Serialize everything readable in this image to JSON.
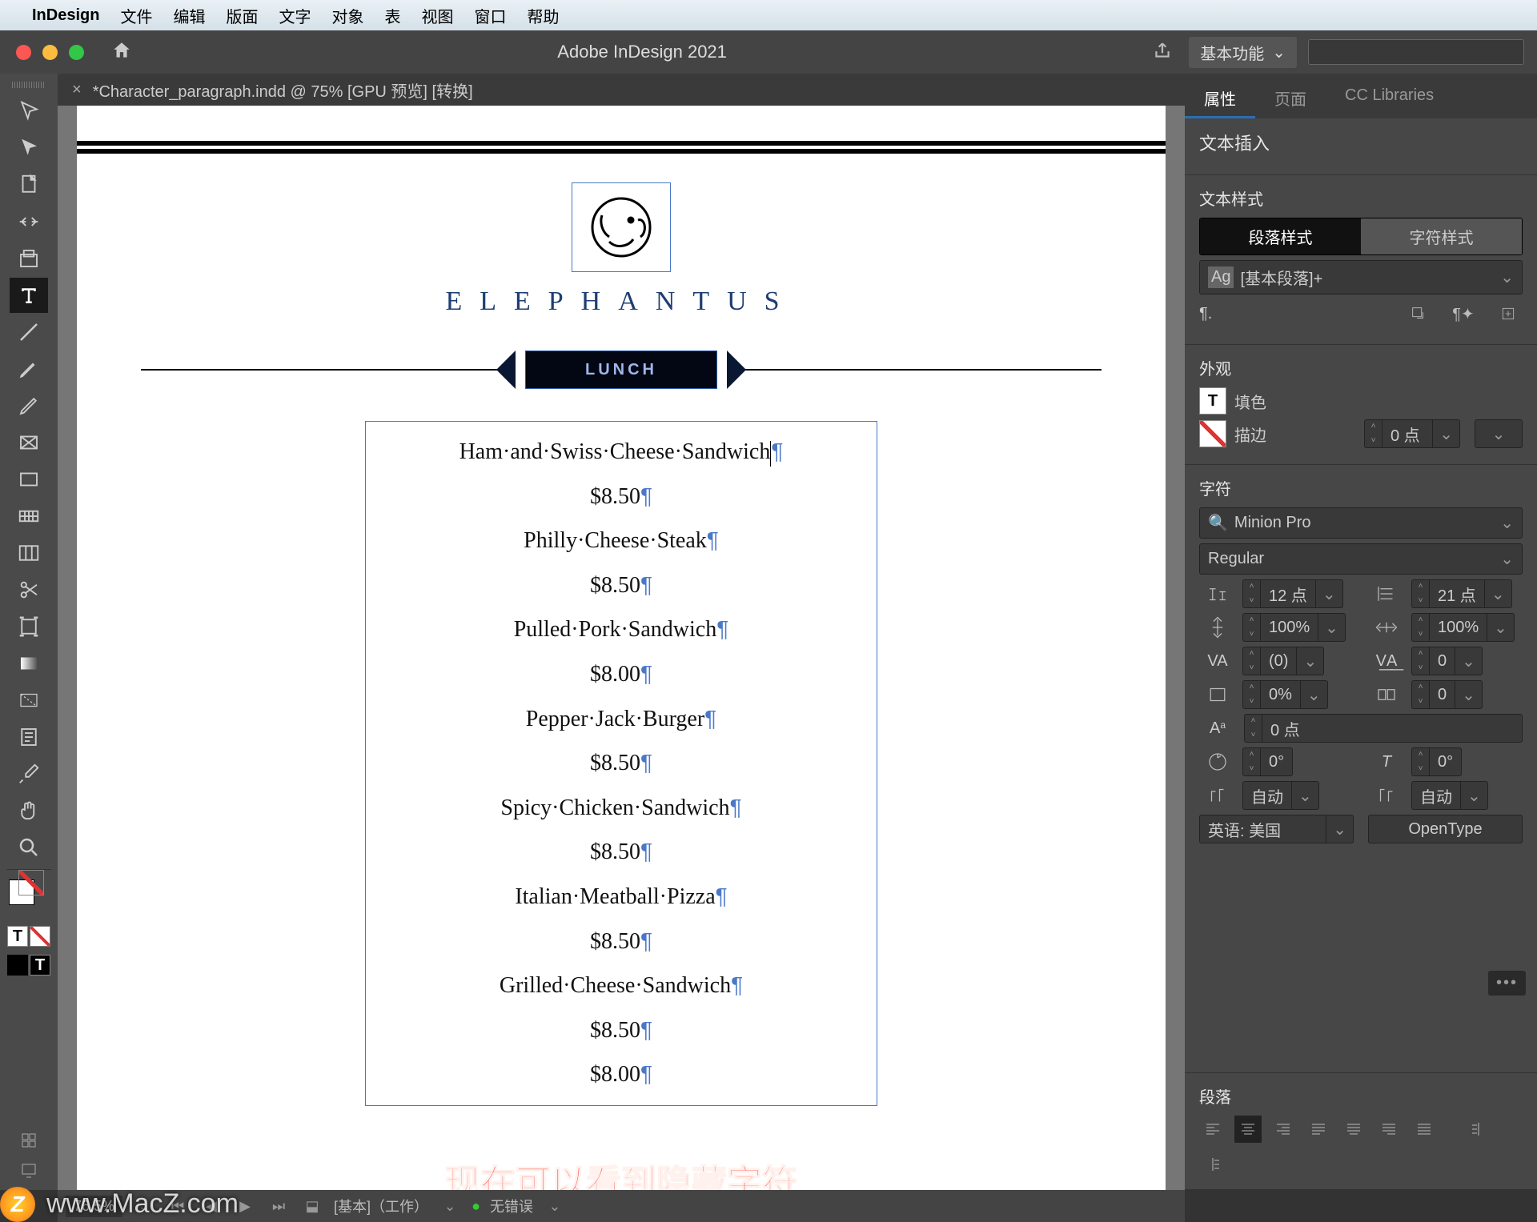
{
  "menubar": {
    "items": [
      "InDesign",
      "文件",
      "编辑",
      "版面",
      "文字",
      "对象",
      "表",
      "视图",
      "窗口",
      "帮助"
    ]
  },
  "appbar": {
    "title": "Adobe InDesign 2021",
    "workspace": "基本功能"
  },
  "doctab": {
    "label": "*Character_paragraph.indd @ 75% [GPU 预览] [转换]"
  },
  "rpanel": {
    "tabs": [
      "属性",
      "页面",
      "CC Libraries"
    ],
    "insert_label": "文本插入",
    "textstyle": {
      "title": "文本样式",
      "seg": [
        "段落样式",
        "字符样式"
      ],
      "style_name": "[基本段落]+",
      "pilcrow": "¶."
    },
    "appearance": {
      "title": "外观",
      "fill": "填色",
      "stroke": "描边",
      "stroke_val": "0 点"
    },
    "character": {
      "title": "字符",
      "font": "Minion Pro",
      "weight": "Regular",
      "size": "12 点",
      "leading": "21 点",
      "hscale": "100%",
      "vscale": "100%",
      "kerning": "(0)",
      "tracking": "0",
      "baseline": "0%",
      "other0": "0",
      "shift": "0 点",
      "rot1": "0°",
      "rot2": "0°",
      "auto1": "自动",
      "auto2": "自动",
      "lang": "英语: 美国",
      "opentype": "OpenType"
    },
    "paragraph": {
      "title": "段落"
    }
  },
  "doc": {
    "brand": "ELEPHANTUS",
    "lunch": "LUNCH",
    "menu": [
      {
        "name": "Ham·and·Swiss·Cheese·Sandwich",
        "price": "$8.50"
      },
      {
        "name": "Philly·Cheese·Steak",
        "price": "$8.50"
      },
      {
        "name": "Pulled·Pork·Sandwich",
        "price": "$8.00"
      },
      {
        "name": "Pepper·Jack·Burger",
        "price": "$8.50"
      },
      {
        "name": "Spicy·Chicken·Sandwich",
        "price": "$8.50"
      },
      {
        "name": "Italian·Meatball·Pizza",
        "price": "$8.50"
      },
      {
        "name": "Grilled·Cheese·Sandwich",
        "price": "$8.50"
      },
      {
        "name": "",
        "price": "$8.00"
      }
    ],
    "caption": "现在可以看到隐藏字符"
  },
  "bottombar": {
    "zoom": "76.5%",
    "worklabel": "[基本]（工作）",
    "errors": "无错误"
  },
  "watermark": "www.MacZ.com",
  "corner": "Z"
}
